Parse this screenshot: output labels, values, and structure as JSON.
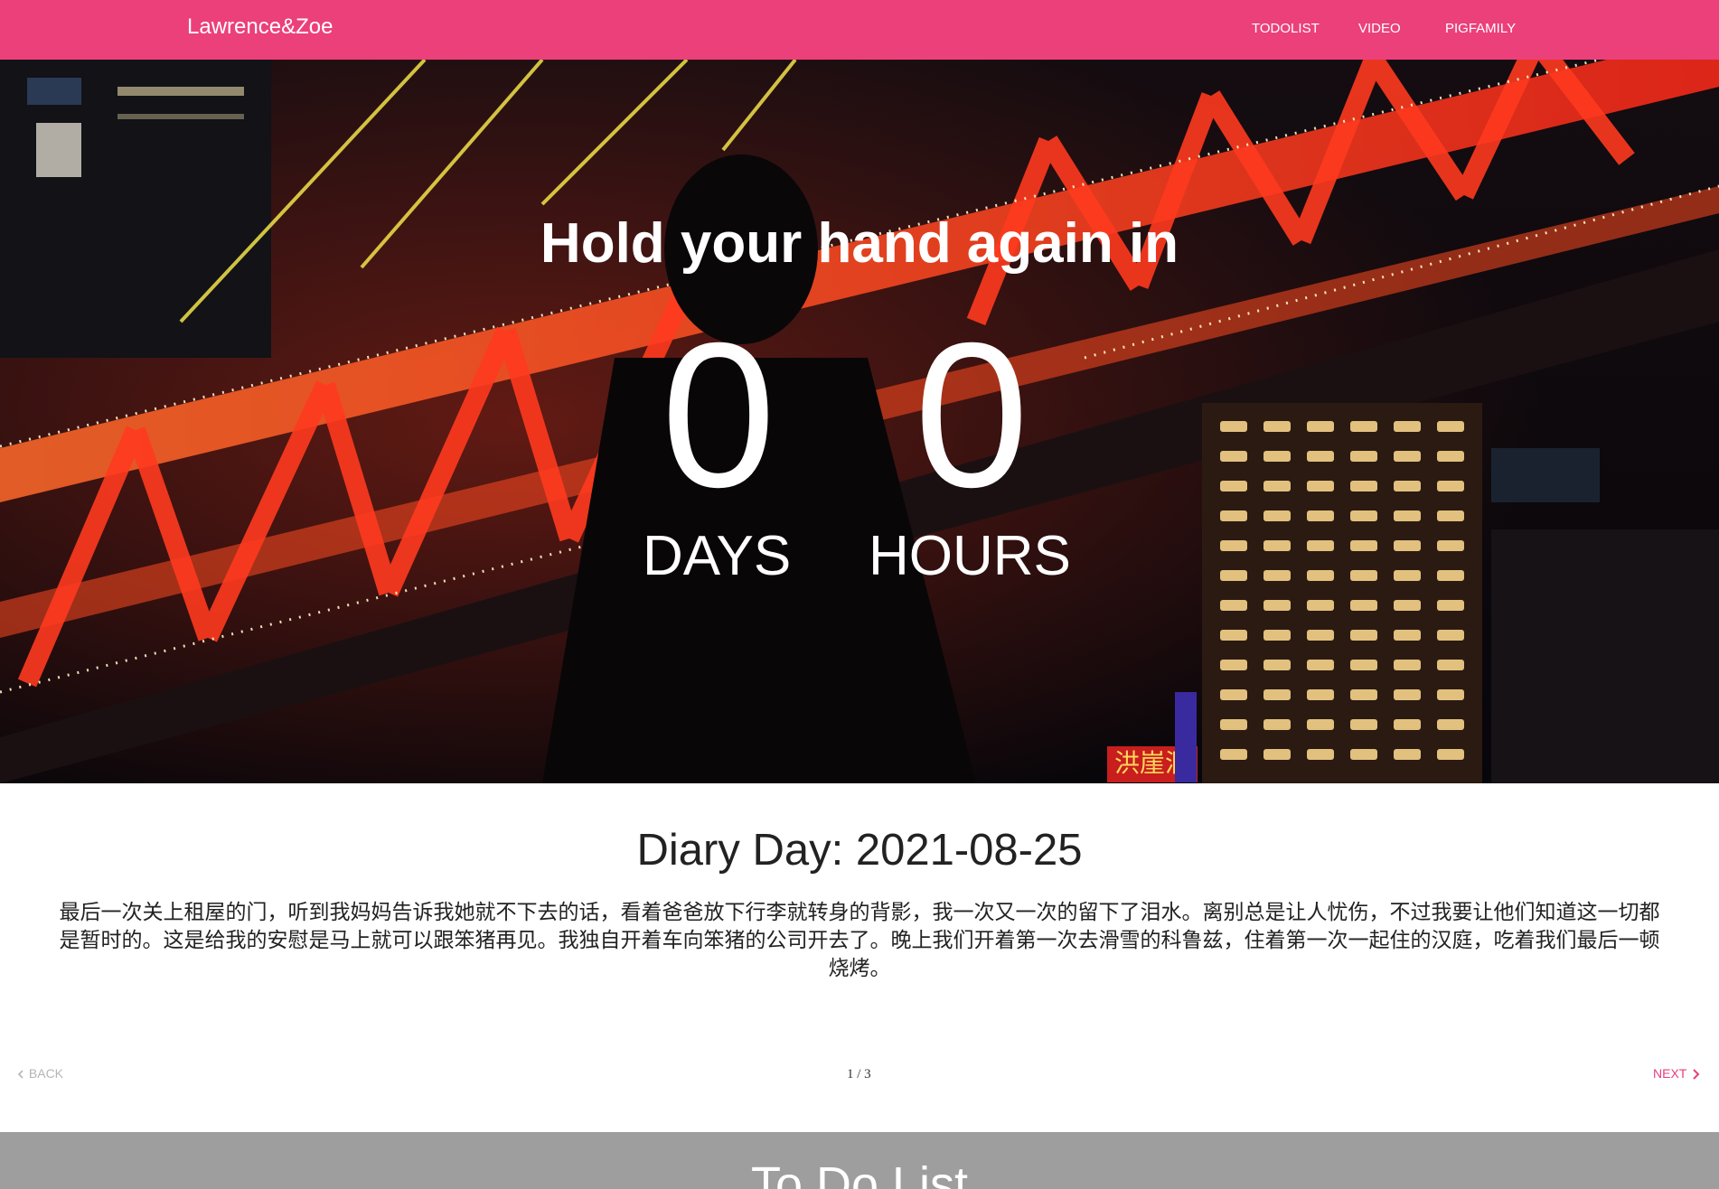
{
  "colors": {
    "navbar": "#ec407a",
    "accent": "#e83d7e",
    "todo_background": "#9e9e9e",
    "hero_red": "#ff3a1f"
  },
  "navbar": {
    "brand": "Lawrence&Zoe",
    "links": [
      {
        "label": "TODOLIST"
      },
      {
        "label": "VIDEO"
      },
      {
        "label": "PIGFAMILY"
      }
    ]
  },
  "hero": {
    "title": "Hold your hand again in",
    "countdown": {
      "days_value": "0",
      "days_label": "DAYS",
      "hours_value": "0",
      "hours_label": "HOURS"
    }
  },
  "diary": {
    "title": "Diary Day: 2021-08-25",
    "text": "最后一次关上租屋的门，听到我妈妈告诉我她就不下去的话，看着爸爸放下行李就转身的背影，我一次又一次的留下了泪水。离别总是让人忧伤，不过我要让他们知道这一切都是暂时的。这是给我的安慰是马上就可以跟笨猪再见。我独自开着车向笨猪的公司开去了。晚上我们开着第一次去滑雪的科鲁兹，住着第一次一起住的汉庭，吃着我们最后一顿烧烤。",
    "sign_text": "洪崖洞",
    "pager": {
      "back_label": "BACK",
      "next_label": "NEXT",
      "count": "1 / 3",
      "back_icon": "chevron-left-icon",
      "next_icon": "chevron-right-icon"
    }
  },
  "todo": {
    "title": "To Do List"
  }
}
